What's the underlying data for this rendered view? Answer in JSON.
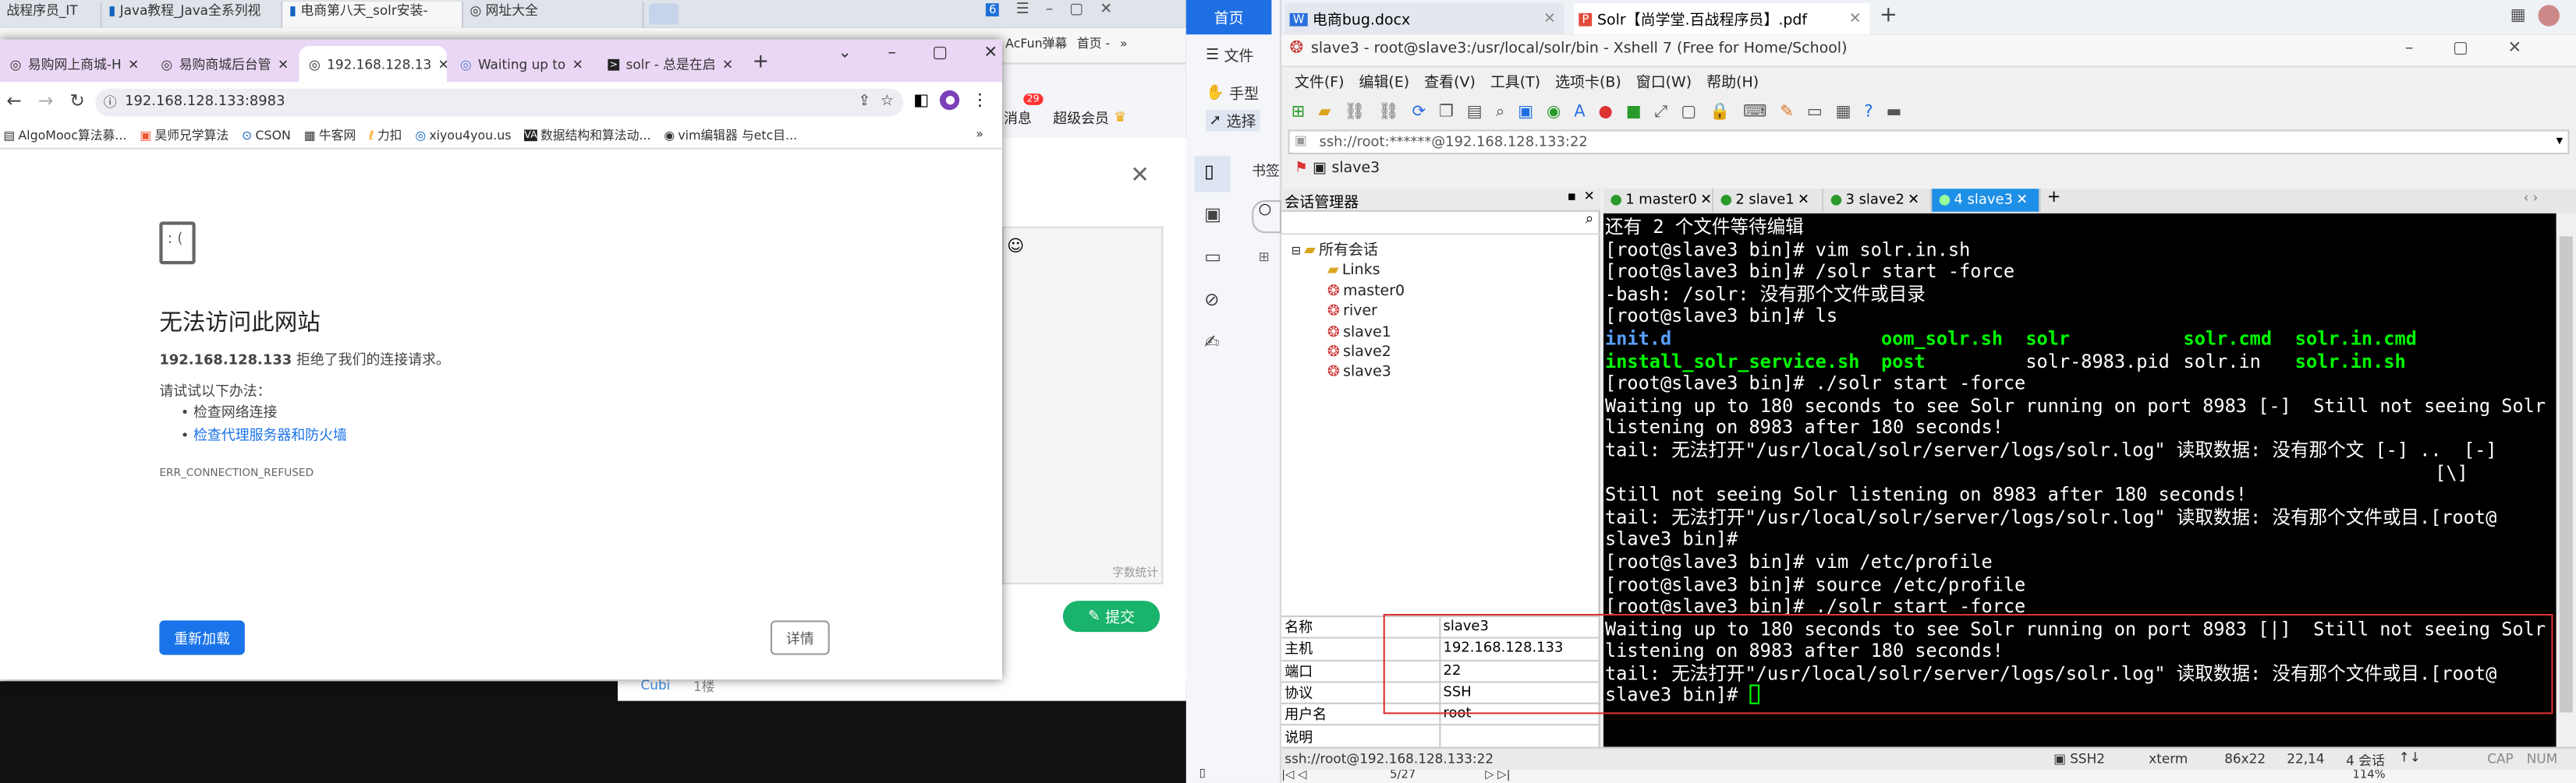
{
  "left_browser": {
    "tabs": [
      "战程序员_IT",
      "Java教程_Java全系列视",
      "电商第八天_solr安装-",
      "网址大全"
    ],
    "right_partial": [
      "AcFun弹幕",
      "首页 -"
    ],
    "page": {
      "messages": "消息",
      "messages_badge": "29",
      "vip": "超级会员",
      "char_count": "字数统计",
      "submit": "提交",
      "user": "Cubi",
      "floor": "1楼"
    }
  },
  "chrome": {
    "tabs": [
      "易购网上商城-H",
      "易购商城后台管",
      "192.168.128.13",
      "Waiting up to",
      "solr - 总是在启"
    ],
    "url": "192.168.128.133:8983",
    "bookmarks": [
      "AlgoMooc算法募...",
      "昊师兄学算法",
      "CSON",
      "牛客网",
      "力扣",
      "xiyou4you.us",
      "数据结构和算法动...",
      "vim编辑器 与etc目..."
    ],
    "error": {
      "title": "无法访问此网站",
      "host": "192.168.128.133",
      "desc": " 拒绝了我们的连接请求。",
      "try": "请试试以下办法：",
      "tips": [
        "检查网络连接",
        "检查代理服务器和防火墙"
      ],
      "code": "ERR_CONNECTION_REFUSED",
      "reload": "重新加载",
      "details": "详情"
    }
  },
  "wps_strip": {
    "home": "首页",
    "file": "文件",
    "hand": "手型",
    "select": "选择",
    "bookmark": "书签"
  },
  "top_tabs": {
    "docx": "电商bug.docx",
    "pdf": "Solr【尚学堂.百战程序员】.pdf"
  },
  "xshell": {
    "title": "slave3 - root@slave3:/usr/local/solr/bin - Xshell 7 (Free for Home/School)",
    "menus": [
      "文件(F)",
      "编辑(E)",
      "查看(V)",
      "工具(T)",
      "选项卡(B)",
      "窗口(W)",
      "帮助(H)"
    ],
    "address": "ssh://root:******@192.168.128.133:22",
    "bookmark_session": "slave3",
    "session_manager": "会话管理器",
    "tree_root": "所有会话",
    "tree": [
      "Links",
      "master0",
      "river",
      "slave1",
      "slave2",
      "slave3"
    ],
    "tabs": [
      "1 master0",
      "2 slave1",
      "3 slave2",
      "4 slave3"
    ],
    "props": [
      [
        "名称",
        "slave3"
      ],
      [
        "主机",
        "192.168.128.133"
      ],
      [
        "端口",
        "22"
      ],
      [
        "协议",
        "SSH"
      ],
      [
        "用户名",
        "root"
      ],
      [
        "说明",
        ""
      ]
    ],
    "terminal": {
      "l1": "还有 2 个文件等待编辑",
      "l2": "[root@slave3 bin]# vim solr.in.sh",
      "l3": "[root@slave3 bin]# /solr start -force",
      "l4": "-bash: /solr: 没有那个文件或目录",
      "l5": "[root@slave3 bin]# ls",
      "ls1": [
        "init.d",
        "oom_solr.sh",
        "solr",
        "solr.cmd",
        "solr.in.cmd"
      ],
      "ls2": [
        "install_solr_service.sh",
        "post",
        "solr-8983.pid",
        "solr.in",
        "solr.in.sh"
      ],
      "l8": "[root@slave3 bin]# ./solr start -force",
      "l9": "Waiting up to 180 seconds to see Solr running on port 8983 [-]  Still not seeing Solr",
      "l10": "listening on 8983 after 180 seconds!",
      "l11": "tail: 无法打开\"/usr/local/solr/server/logs/solr.log\" 读取数据: 没有那个文 [-] ..  [-]",
      "l12": "                                                                           [\\]",
      "l13": "Still not seeing Solr listening on 8983 after 180 seconds!",
      "l14": "tail: 无法打开\"/usr/local/solr/server/logs/solr.log\" 读取数据: 没有那个文件或目.[root@",
      "l15": "slave3 bin]#",
      "l16": "[root@slave3 bin]# vim /etc/profile",
      "l17": "[root@slave3 bin]# source /etc/profile",
      "l18": "[root@slave3 bin]# ./solr start -force",
      "l19": "Waiting up to 180 seconds to see Solr running on port 8983 [|]  Still not seeing Solr",
      "l20": "listening on 8983 after 180 seconds!",
      "l21": "tail: 无法打开\"/usr/local/solr/server/logs/solr.log\" 读取数据: 没有那个文件或目.[root@",
      "l22": "slave3 bin]# "
    },
    "status": {
      "conn": "ssh://root@192.168.128.133:22",
      "proto": "SSH2",
      "term": "xterm",
      "size": "86x22",
      "pos": "22,14",
      "sessions": "4 会话",
      "cap": "CAP",
      "num": "NUM"
    }
  },
  "pdf_footer": {
    "pages": "5/27",
    "zoom": "114%"
  },
  "colors": {
    "highlight_box": "#e03030",
    "term_bg": "#000000",
    "tab_active": "#1e8fe6",
    "submit": "#19b36b",
    "reload": "#1a73e8"
  }
}
